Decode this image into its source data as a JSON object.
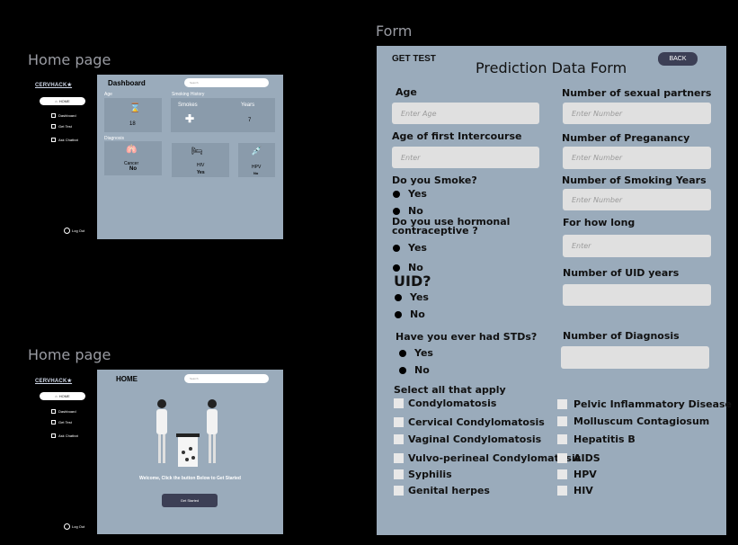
{
  "frames": {
    "home1_title": "Home page",
    "home2_title": "Home page",
    "form_title": "Form"
  },
  "sidebar": {
    "logo": "CERVHACK★",
    "home": "HOME",
    "items": [
      "Dashboard",
      "Get Test",
      "Ask Chatbot"
    ],
    "logout": "Log Out"
  },
  "dashboard": {
    "title": "Dashboard",
    "search_placeholder": "Search",
    "age_label": "Age",
    "age_value": "18",
    "smoking_label": "Smoking History",
    "smokes": "Smokes",
    "years": "Years",
    "years_value": "7",
    "diagnosis_label": "Diagnosis",
    "cancer": "Cancer",
    "cancer_value": "No",
    "hiv": "HIV",
    "hiv_value": "Yes",
    "hpv": "HPV",
    "hpv_value": "No"
  },
  "home": {
    "title": "HOME",
    "search_placeholder": "Search",
    "welcome": "Welcome, Click the button Below to Get Started",
    "get_started": "Get Started"
  },
  "form": {
    "get_test": "GET TEST",
    "title": "Prediction Data  Form",
    "back": "BACK",
    "left": {
      "age_label": "Age",
      "age_placeholder": "Enter Age",
      "first_intercourse_label": "Age of first Intercourse",
      "first_intercourse_placeholder": "Enter",
      "smoke_label": "Do you Smoke?",
      "smoke_yes": "Yes",
      "smoke_no": "No",
      "hormonal_label_1": "Do you use hormonal",
      "hormonal_label_2": "contraceptive ?",
      "hormonal_yes": "Yes",
      "hormonal_no": "No",
      "uid_label": "UID?",
      "uid_yes": "Yes",
      "uid_no": "No",
      "std_label": "Have you ever had STDs?",
      "std_yes": "Yes",
      "std_no": "No",
      "select_label": "Select all that apply"
    },
    "right": {
      "partners_label": "Number of sexual partners",
      "partners_placeholder": "Enter Number",
      "pregnancy_label": "Number of Preganancy",
      "pregnancy_placeholder": "Enter Number",
      "smoking_years_label": "Number of Smoking Years",
      "smoking_years_placeholder": "Enter Number",
      "how_long_label": "For how long",
      "how_long_placeholder": "Enter",
      "uid_years_label": "Number of UID years",
      "diagnosis_label": "Number of Diagnosis"
    },
    "checks_left": [
      "Condylomatosis",
      "Cervical Condylomatosis",
      "Vaginal Condylomatosis",
      "Vulvo-perineal Condylomatosis",
      "Syphilis",
      "Genital herpes"
    ],
    "checks_right": [
      "Pelvic  Inflammatory Disease",
      "Molluscum Contagiosum",
      "Hepatitis B",
      "AIDS",
      "HPV",
      "HIV"
    ]
  }
}
